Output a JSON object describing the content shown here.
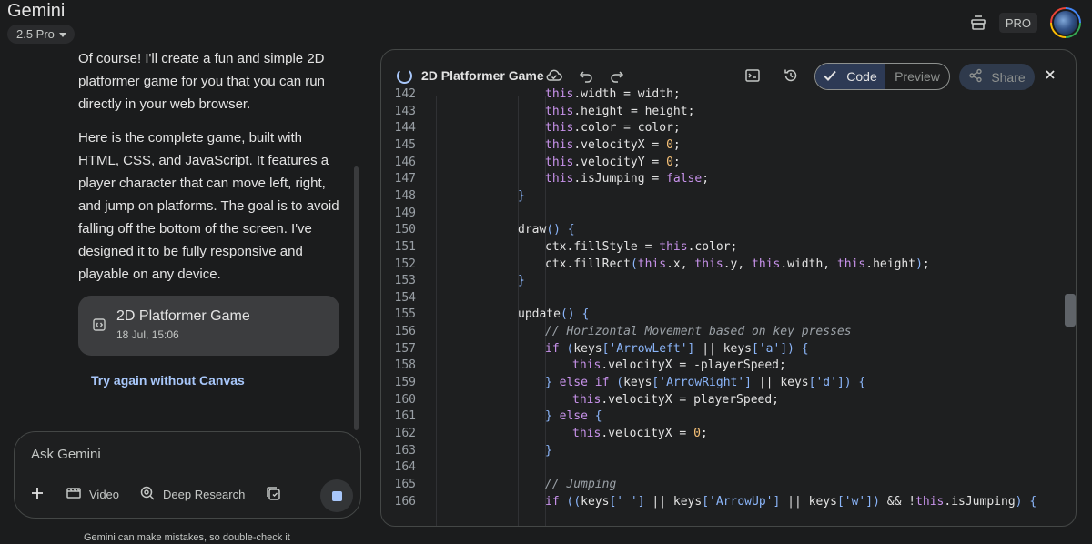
{
  "app": {
    "title": "Gemini",
    "model": "2.5 Pro",
    "pro_badge": "PRO"
  },
  "chat": {
    "paragraphs": [
      "Of course! I'll create a fun and simple 2D platformer game for you that you can run directly in your web browser.",
      "Here is the complete game, built with HTML, CSS, and JavaScript. It features a player character that can move left, right, and jump on platforms. The goal is to avoid falling off the bottom of the screen. I've designed it to be fully responsive and playable on any device."
    ],
    "doc_card": {
      "title": "2D Platformer Game",
      "date": "18 Jul, 15:06"
    },
    "try_again": "Try again without Canvas"
  },
  "input": {
    "placeholder": "Ask Gemini",
    "tools": {
      "video": "Video",
      "deep_research": "Deep Research"
    },
    "disclaimer": "Gemini can make mistakes, so double-check it"
  },
  "canvas": {
    "title": "2D Platformer Game",
    "code_tab": "Code",
    "preview_tab": "Preview",
    "share": "Share",
    "code_lines": [
      {
        "n": "142",
        "text": "this.width = width;"
      },
      {
        "n": "143",
        "text": "this.height = height;"
      },
      {
        "n": "144",
        "text": "this.color = color;"
      },
      {
        "n": "145",
        "text": "this.velocityX = 0;"
      },
      {
        "n": "146",
        "text": "this.velocityY = 0;"
      },
      {
        "n": "147",
        "text": "this.isJumping = false;"
      },
      {
        "n": "148",
        "text": "}"
      },
      {
        "n": "149",
        "text": ""
      },
      {
        "n": "150",
        "text": "draw() {"
      },
      {
        "n": "151",
        "text": "ctx.fillStyle = this.color;"
      },
      {
        "n": "152",
        "text": "ctx.fillRect(this.x, this.y, this.width, this.height);"
      },
      {
        "n": "153",
        "text": "}"
      },
      {
        "n": "154",
        "text": ""
      },
      {
        "n": "155",
        "text": "update() {"
      },
      {
        "n": "156",
        "text": "// Horizontal Movement based on key presses"
      },
      {
        "n": "157",
        "text": "if (keys['ArrowLeft'] || keys['a']) {"
      },
      {
        "n": "158",
        "text": "this.velocityX = -playerSpeed;"
      },
      {
        "n": "159",
        "text": "} else if (keys['ArrowRight'] || keys['d']) {"
      },
      {
        "n": "160",
        "text": "this.velocityX = playerSpeed;"
      },
      {
        "n": "161",
        "text": "} else {"
      },
      {
        "n": "162",
        "text": "this.velocityX = 0;"
      },
      {
        "n": "163",
        "text": "}"
      },
      {
        "n": "164",
        "text": ""
      },
      {
        "n": "165",
        "text": "// Jumping"
      },
      {
        "n": "166",
        "text": "if ((keys[' '] || keys['ArrowUp'] || keys['w']) && !this.isJumping) {"
      }
    ]
  }
}
